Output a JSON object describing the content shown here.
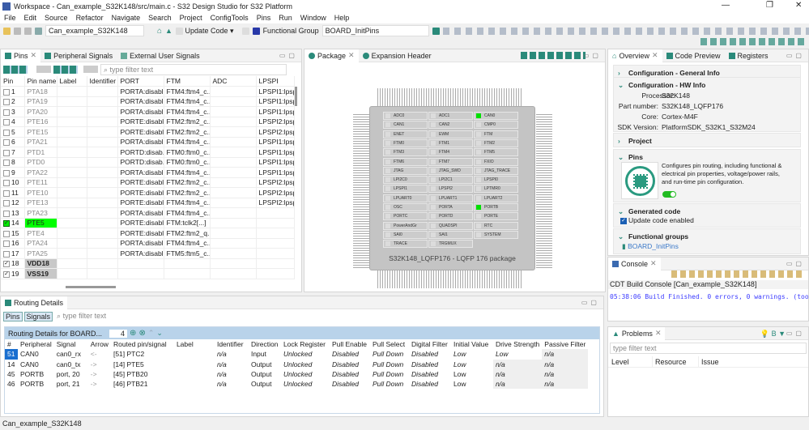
{
  "window": {
    "title": "Workspace - Can_example_S32K148/src/main.c - S32 Design Studio for S32 Platform"
  },
  "menu": [
    "File",
    "Edit",
    "Source",
    "Refactor",
    "Navigate",
    "Search",
    "Project",
    "ConfigTools",
    "Pins",
    "Run",
    "Window",
    "Help"
  ],
  "toolbar": {
    "project": "Can_example_S32K148",
    "update_code": "Update Code",
    "functional_group_label": "Functional Group",
    "functional_group": "BOARD_InitPins"
  },
  "pins_panel": {
    "tabs": [
      "Pins",
      "Peripheral Signals",
      "External User Signals"
    ],
    "filter_placeholder": "type filter text",
    "columns": [
      "Pin",
      "Pin name",
      "Label",
      "Identifier",
      "PORT",
      "FTM",
      "ADC",
      "LPSPI"
    ],
    "rows": [
      {
        "pin": "1",
        "name": "PTA18",
        "port": "PORTA:disabl...",
        "ftm": "FTM4:ftm4_c...",
        "lpspi": "LPSPI1:lpspi"
      },
      {
        "pin": "2",
        "name": "PTA19",
        "port": "PORTA:disabl...",
        "ftm": "FTM4:ftm4_c...",
        "lpspi": "LPSPI1:lpspi"
      },
      {
        "pin": "3",
        "name": "PTA20",
        "port": "PORTA:disabl...",
        "ftm": "FTM4:ftm4_c...",
        "lpspi": "LPSPI1:lpspi"
      },
      {
        "pin": "4",
        "name": "PTE16",
        "port": "PORTE:disabl...",
        "ftm": "FTM2:ftm2_c...",
        "lpspi": "LPSPI2:lpspi"
      },
      {
        "pin": "5",
        "name": "PTE15",
        "port": "PORTE:disabl...",
        "ftm": "FTM2:ftm2_c...",
        "lpspi": "LPSPI2:lpspi"
      },
      {
        "pin": "6",
        "name": "PTA21",
        "port": "PORTA:disabl...",
        "ftm": "FTM4:ftm4_c...",
        "lpspi": "LPSPI1:lpspi"
      },
      {
        "pin": "7",
        "name": "PTD1",
        "port": "PORTD:disab...",
        "ftm": "FTM0:ftm0_c...",
        "lpspi": "LPSPI1:lpspi"
      },
      {
        "pin": "8",
        "name": "PTD0",
        "port": "PORTD:disab...",
        "ftm": "FTM0:ftm0_c...",
        "lpspi": "LPSPI1:lpspi"
      },
      {
        "pin": "9",
        "name": "PTA22",
        "port": "PORTA:disabl...",
        "ftm": "FTM4:ftm4_c...",
        "lpspi": "LPSPI1:lpspi"
      },
      {
        "pin": "10",
        "name": "PTE11",
        "port": "PORTE:disabl...",
        "ftm": "FTM2:ftm2_c...",
        "lpspi": "LPSPI2:lpspi"
      },
      {
        "pin": "11",
        "name": "PTE10",
        "port": "PORTE:disabl...",
        "ftm": "FTM2:ftm2_c...",
        "lpspi": "LPSPI2:lpspi"
      },
      {
        "pin": "12",
        "name": "PTE13",
        "port": "PORTE:disabl...",
        "ftm": "FTM4:ftm4_c...",
        "lpspi": "LPSPI2:lpspi"
      },
      {
        "pin": "13",
        "name": "PTA23",
        "port": "PORTA:disabl...",
        "ftm": "FTM4:ftm4_c...",
        "lpspi": ""
      },
      {
        "pin": "14",
        "name": "PTE5",
        "port": "PORTE:disabl...",
        "ftm": "FTM:tclk2[...]",
        "lpspi": "",
        "checked": true,
        "routed": true
      },
      {
        "pin": "15",
        "name": "PTE4",
        "port": "PORTE:disabl...",
        "ftm": "FTM2:ftm2_q...",
        "lpspi": ""
      },
      {
        "pin": "16",
        "name": "PTA24",
        "port": "PORTA:disabl...",
        "ftm": "FTM4:ftm4_c...",
        "lpspi": ""
      },
      {
        "pin": "17",
        "name": "PTA25",
        "port": "PORTA:disabl...",
        "ftm": "FTM5:ftm5_c...",
        "lpspi": ""
      },
      {
        "pin": "18",
        "name": "VDD18",
        "port": "",
        "ftm": "",
        "lpspi": "",
        "checked": true,
        "power": true
      },
      {
        "pin": "19",
        "name": "VSS19",
        "port": "",
        "ftm": "",
        "lpspi": "",
        "checked": true,
        "power": true
      }
    ]
  },
  "package_panel": {
    "tabs": [
      "Package",
      "Expansion Header"
    ],
    "package_name": "S32K148_LQFP176 - LQFP 176 package",
    "blocks": [
      {
        "n": "ADC0"
      },
      {
        "n": "ADC1"
      },
      {
        "n": "CAN0",
        "on": true
      },
      {
        "n": "CAN1"
      },
      {
        "n": "CAN2"
      },
      {
        "n": "CMP0"
      },
      {
        "n": "ENET"
      },
      {
        "n": "EWM"
      },
      {
        "n": "FTM"
      },
      {
        "n": "FTM0"
      },
      {
        "n": "FTM1"
      },
      {
        "n": "FTM2"
      },
      {
        "n": "FTM3"
      },
      {
        "n": "FTM4"
      },
      {
        "n": "FTM5"
      },
      {
        "n": "FTM6"
      },
      {
        "n": "FTM7"
      },
      {
        "n": "FXIO"
      },
      {
        "n": "JTAG"
      },
      {
        "n": "JTAG_SWD"
      },
      {
        "n": "JTAG_TRACE"
      },
      {
        "n": "LPI2C0"
      },
      {
        "n": "LPI2C1"
      },
      {
        "n": "LPSPI0"
      },
      {
        "n": "LPSPI1"
      },
      {
        "n": "LPSPI2"
      },
      {
        "n": "LPTMR0"
      },
      {
        "n": "LPUART0"
      },
      {
        "n": "LPUART1"
      },
      {
        "n": "LPUART2"
      },
      {
        "n": "OSC"
      },
      {
        "n": "PORTA"
      },
      {
        "n": "PORTB",
        "on": true
      },
      {
        "n": "PORTC"
      },
      {
        "n": "PORTD"
      },
      {
        "n": "PORTE"
      },
      {
        "n": "PowerAndGr"
      },
      {
        "n": "QUADSPI"
      },
      {
        "n": "RTC"
      },
      {
        "n": "SAI0"
      },
      {
        "n": "SAI1"
      },
      {
        "n": "SYSTEM"
      },
      {
        "n": "TRACE"
      },
      {
        "n": "TRGMUX"
      }
    ]
  },
  "overview": {
    "tabs": [
      "Overview",
      "Code Preview",
      "Registers"
    ],
    "general_info": "Configuration - General Info",
    "hw_info": "Configuration - HW Info",
    "processor_label": "Processor:",
    "processor": "S32K148",
    "part_label": "Part number:",
    "part": "S32K148_LQFP176",
    "core_label": "Core:",
    "core": "Cortex-M4F",
    "sdk_label": "SDK Version:",
    "sdk": "PlatformSDK_S32K1_S32M24",
    "project": "Project",
    "pins": "Pins",
    "pins_desc": "Configures pin routing, including functional & electrical pin properties, voltage/power rails, and run-time pin configuration.",
    "pins_enabled": true,
    "generated_code": "Generated code",
    "update_code_enabled": "Update code enabled",
    "functional_groups": "Functional groups",
    "group": "BOARD_InitPins"
  },
  "console": {
    "tab": "Console",
    "title": "CDT Build Console [Can_example_S32K148]",
    "line": "05:38:06 Build Finished. 0 errors, 0 warnings. (too"
  },
  "problems": {
    "tab": "Problems",
    "filter_placeholder": "type filter text",
    "columns": [
      "Level",
      "Resource",
      "Issue"
    ]
  },
  "routing": {
    "tab": "Routing Details",
    "btn_pins": "Pins",
    "btn_signals": "Signals",
    "filter_placeholder": "type filter text",
    "header": "Routing Details for BOARD...",
    "count": "4",
    "columns": [
      "#",
      "Peripheral",
      "Signal",
      "Arrow",
      "Routed pin/signal",
      "Label",
      "Identifier",
      "Direction",
      "Lock Register",
      "Pull Enable",
      "Pull Select",
      "Digital Filter",
      "Initial Value",
      "Drive Strength",
      "Passive Filter"
    ],
    "rows": [
      [
        "51",
        "CAN0",
        "can0_rx",
        "<-",
        "[51] PTC2",
        "",
        "n/a",
        "Input",
        "Unlocked",
        "Disabled",
        "Pull Down",
        "Disabled",
        "Low",
        "Low",
        "n/a"
      ],
      [
        "14",
        "CAN0",
        "can0_tx",
        "->",
        "[14] PTE5",
        "",
        "n/a",
        "Output",
        "Unlocked",
        "Disabled",
        "Pull Down",
        "Disabled",
        "Low",
        "n/a",
        "n/a"
      ],
      [
        "45",
        "PORTB",
        "port, 20",
        "->",
        "[45] PTB20",
        "",
        "n/a",
        "Output",
        "Unlocked",
        "Disabled",
        "Pull Down",
        "Disabled",
        "Low",
        "n/a",
        "n/a"
      ],
      [
        "46",
        "PORTB",
        "port, 21",
        "->",
        "[46] PTB21",
        "",
        "n/a",
        "Output",
        "Unlocked",
        "Disabled",
        "Pull Down",
        "Disabled",
        "Low",
        "n/a",
        "n/a"
      ]
    ]
  },
  "status": "Can_example_S32K148",
  "colors": {
    "accent": "#2a8a7a",
    "routed": "#00ff00",
    "header_blue": "#b9d3ea",
    "console_text": "#3b3bff"
  }
}
